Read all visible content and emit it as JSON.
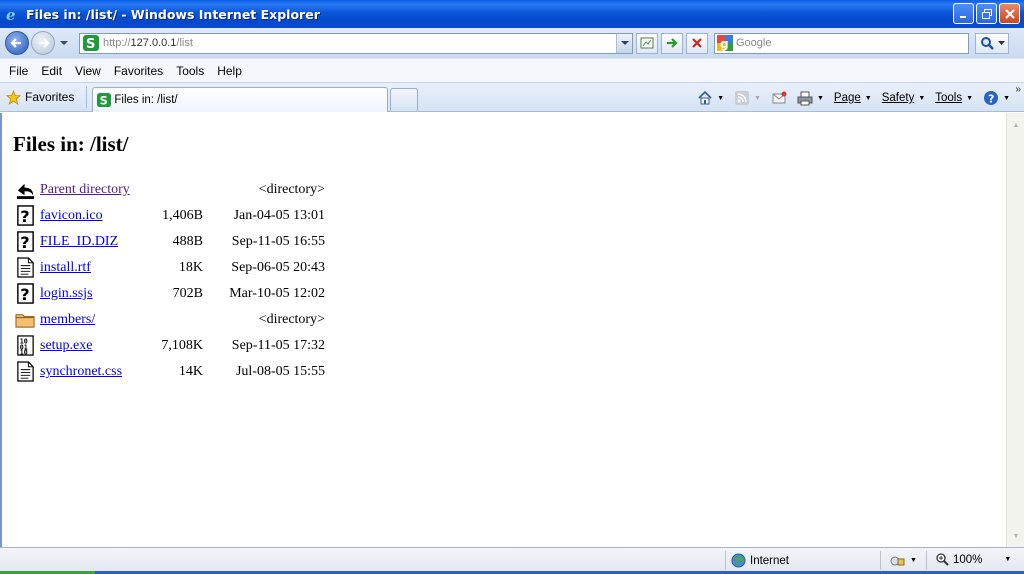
{
  "window": {
    "title": "Files in: /list/ - Windows Internet Explorer"
  },
  "address": {
    "proto": "http://",
    "host": "127.0.0.1",
    "path": "/list"
  },
  "search": {
    "placeholder": "Google"
  },
  "menu": [
    "File",
    "Edit",
    "View",
    "Favorites",
    "Tools",
    "Help"
  ],
  "favorites_label": "Favorites",
  "tab": {
    "title": "Files in: /list/"
  },
  "commands": {
    "page": "Page",
    "safety": "Safety",
    "tools": "Tools"
  },
  "page": {
    "heading": "Files in: /list/",
    "files": [
      {
        "name": "Parent directory",
        "icon": "back-icon",
        "size": "",
        "date": "",
        "kind": "<directory>",
        "visited": true
      },
      {
        "name": "favicon.ico",
        "icon": "unknown-file-icon",
        "size": "1,406B",
        "date": "Jan-04-05 13:01",
        "kind": "",
        "visited": false
      },
      {
        "name": "FILE_ID.DIZ",
        "icon": "unknown-file-icon",
        "size": "488B",
        "date": "Sep-11-05 16:55",
        "kind": "",
        "visited": false
      },
      {
        "name": "install.rtf",
        "icon": "text-file-icon",
        "size": "18K",
        "date": "Sep-06-05 20:43",
        "kind": "",
        "visited": false
      },
      {
        "name": "login.ssjs",
        "icon": "unknown-file-icon",
        "size": "702B",
        "date": "Mar-10-05 12:02",
        "kind": "",
        "visited": false
      },
      {
        "name": "members/",
        "icon": "folder-icon",
        "size": "",
        "date": "",
        "kind": "<directory>",
        "visited": false
      },
      {
        "name": "setup.exe",
        "icon": "binary-file-icon",
        "size": "7,108K",
        "date": "Sep-11-05 17:32",
        "kind": "",
        "visited": false
      },
      {
        "name": "synchronet.css",
        "icon": "text-file-icon",
        "size": "14K",
        "date": "Jul-08-05 15:55",
        "kind": "",
        "visited": false
      }
    ]
  },
  "status": {
    "zone": "Internet",
    "zoom": "100%"
  },
  "colors": {
    "link": "#0000ee",
    "visited": "#551a8b",
    "titlebar": "#0a56d8"
  }
}
